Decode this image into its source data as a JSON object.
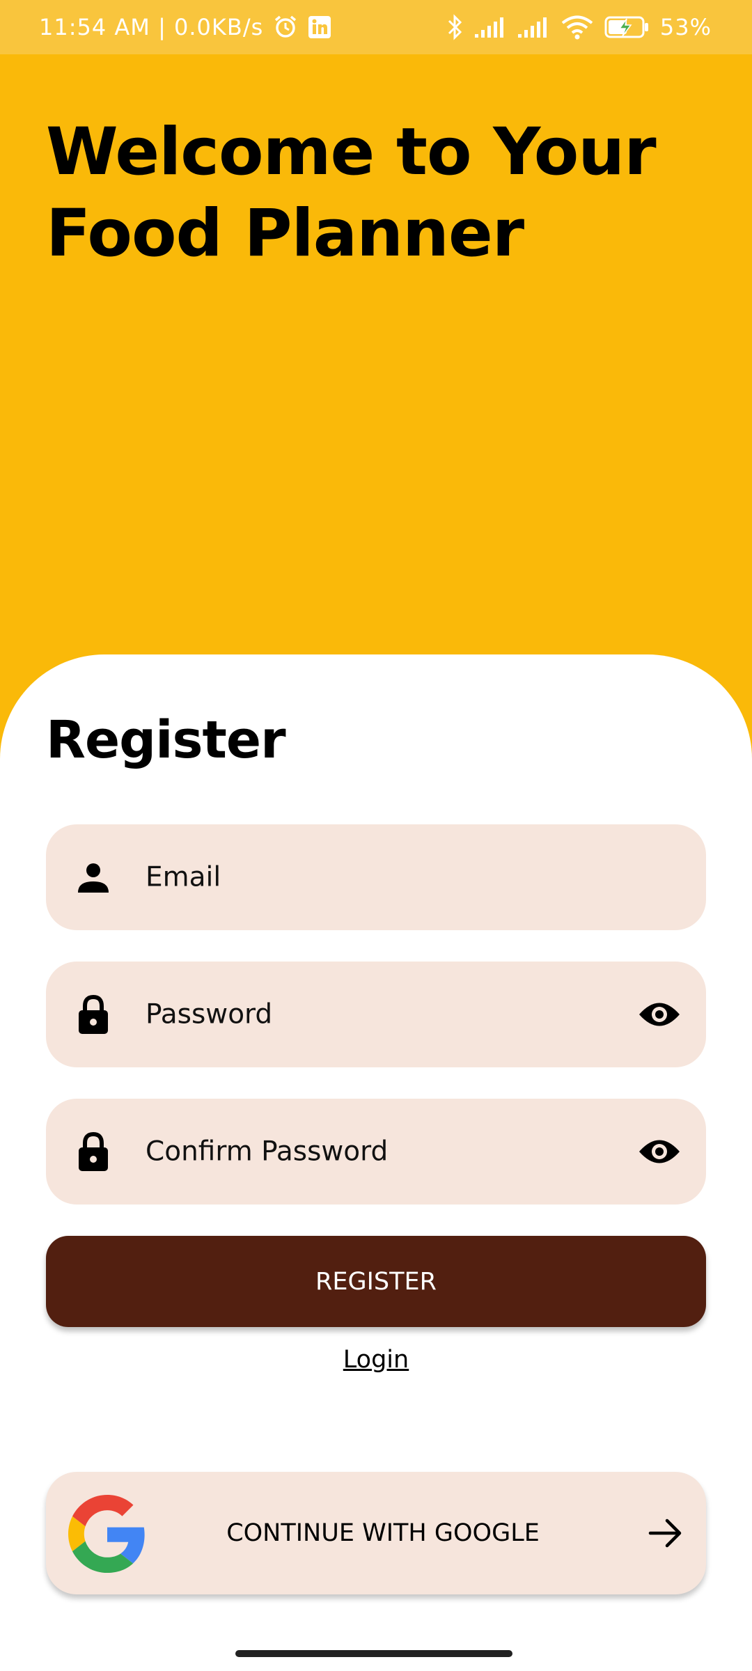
{
  "status_bar": {
    "time": "11:54 AM | 0.0KB/s",
    "battery": "53%",
    "icons": [
      "alarm-icon",
      "linkedin-icon",
      "bluetooth-icon",
      "signal-icon",
      "signal-icon",
      "wifi-icon",
      "battery-charging-icon"
    ]
  },
  "header": {
    "welcome": "Welcome to Your Food Planner"
  },
  "form": {
    "title": "Register",
    "email_placeholder": "Email",
    "password_placeholder": "Password",
    "confirm_placeholder": "Confirm Password",
    "register_label": "REGISTER",
    "login_label": "Login"
  },
  "google": {
    "label": "CONTINUE WITH GOOGLE"
  },
  "colors": {
    "header_bg": "#FAB909",
    "status_bar_bg": "#F9C53D",
    "field_bg": "#F6E5DC",
    "primary_button": "#521F10",
    "sheet_bg": "#FFFFFF"
  }
}
